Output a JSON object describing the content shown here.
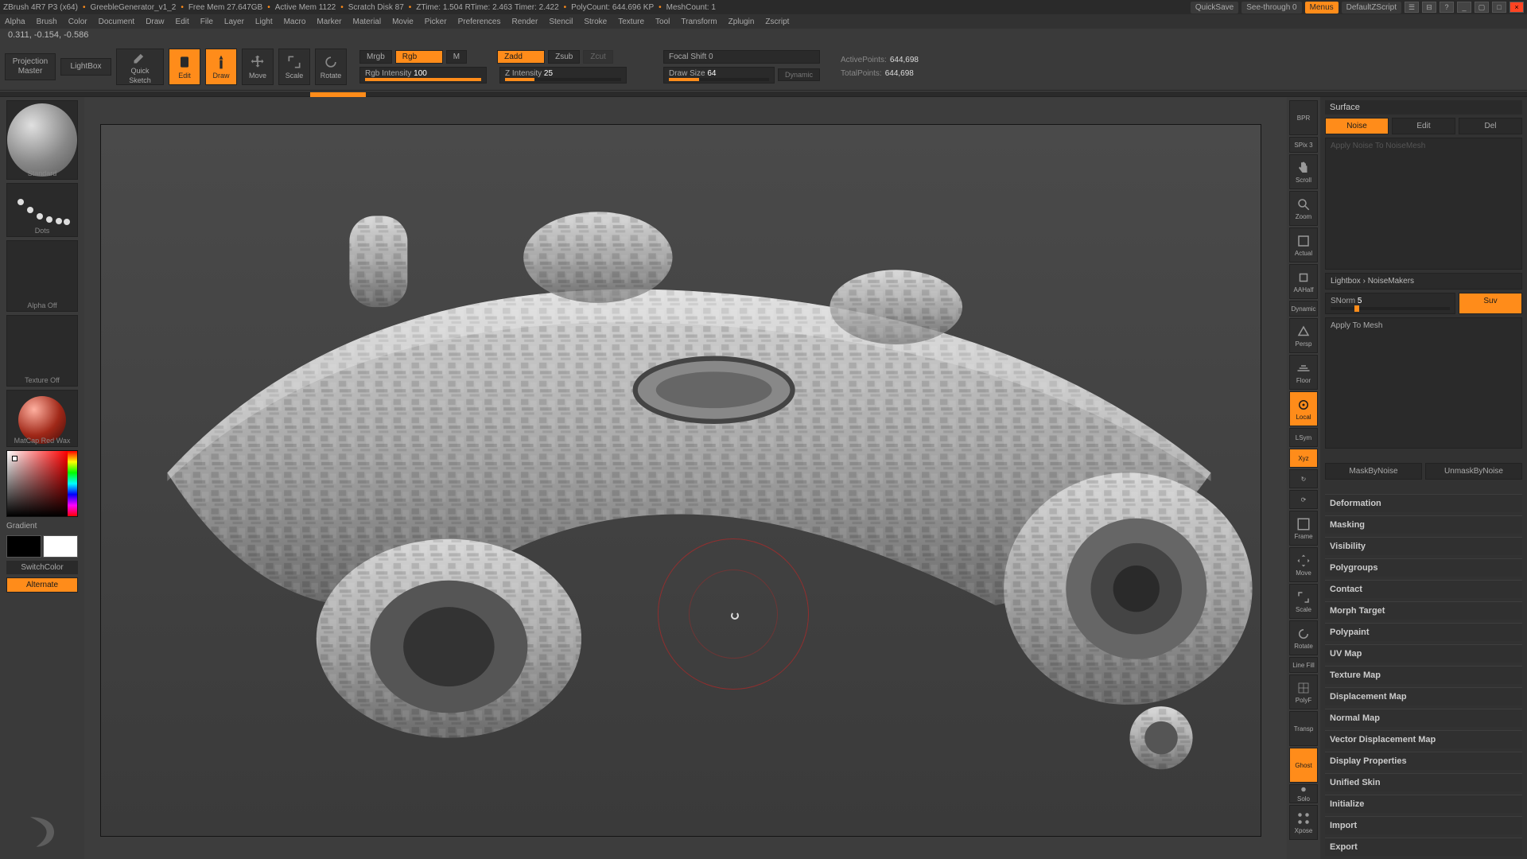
{
  "title": {
    "app": "ZBrush 4R7 P3 (x64)",
    "doc": "GreebleGenerator_v1_2",
    "freemem": "Free Mem 27.647GB",
    "activemem": "Active Mem 1122",
    "scratch": "Scratch Disk 87",
    "ztime": "ZTime: 1.504",
    "rtime": "RTime: 2.463",
    "timer": "Timer: 2.422",
    "polycount": "PolyCount: 644.696 KP",
    "meshcount": "MeshCount: 1",
    "quicksave": "QuickSave",
    "seethrough": "See-through  0",
    "menus": "Menus",
    "defaultscript": "DefaultZScript"
  },
  "menu": [
    "Alpha",
    "Brush",
    "Color",
    "Document",
    "Draw",
    "Edit",
    "File",
    "Layer",
    "Light",
    "Macro",
    "Marker",
    "Material",
    "Movie",
    "Picker",
    "Preferences",
    "Render",
    "Stencil",
    "Stroke",
    "Texture",
    "Tool",
    "Transform",
    "Zplugin",
    "Zscript"
  ],
  "coords": "0.311, -0.154, -0.586",
  "shelf": {
    "projection": [
      "Projection",
      "Master"
    ],
    "lightbox": "LightBox",
    "quicksketch": [
      "Quick",
      "Sketch"
    ],
    "modes": {
      "edit": "Edit",
      "draw": "Draw",
      "move": "Move",
      "scale": "Scale",
      "rotate": "Rotate"
    },
    "row1": {
      "mrgb": "Mrgb",
      "rgb": "Rgb",
      "m": "M",
      "zadd": "Zadd",
      "zsub": "Zsub",
      "zcut": "Zcut"
    },
    "row2": {
      "rgbint_label": "Rgb Intensity",
      "rgbint_val": "100",
      "zint_label": "Z Intensity",
      "zint_val": "25"
    },
    "focalshift": "Focal Shift 0",
    "drawsize_label": "Draw Size",
    "drawsize_val": "64",
    "dynamic": "Dynamic",
    "stats": {
      "active_l": "ActivePoints:",
      "active_v": "644,698",
      "total_l": "TotalPoints:",
      "total_v": "644,698"
    }
  },
  "left": {
    "brush_label": "Standard",
    "stroke_label": "Dots",
    "alpha_label": "Alpha Off",
    "texture_label": "Texture Off",
    "material_label": "MatCap Red Wax",
    "gradient": "Gradient",
    "switchcolor": "SwitchColor",
    "alternate": "Alternate"
  },
  "nav": {
    "bpr": "BPR",
    "spix_label": "SPix",
    "spix_val": "3",
    "scroll": "Scroll",
    "zoom": "Zoom",
    "actual": "Actual",
    "aahalf": "AAHalf",
    "persp": "Persp",
    "floor": "Floor",
    "local": "Local",
    "lsym": "LSym",
    "xyz": "Xyz",
    "frame": "Frame",
    "move": "Move",
    "scale": "Scale",
    "rotate": "Rotate",
    "linefill": "Line Fill",
    "polyf": "PolyF",
    "transp": "Transp",
    "ghost": "Ghost",
    "solo": "Solo",
    "xpose": "Xpose",
    "dynamic": "Dynamic"
  },
  "right": {
    "surface": "Surface",
    "noise": "Noise",
    "edit": "Edit",
    "del": "Del",
    "applynm": "Apply Noise To NoiseMesh",
    "lightbox_nm": "Lightbox › NoiseMakers",
    "snorm_label": "SNorm",
    "snorm_val": "5",
    "suv": "Suv",
    "applymesh": "Apply To Mesh",
    "maskby": "MaskByNoise",
    "unmaskby": "UnmaskByNoise",
    "accordion": [
      "Deformation",
      "Masking",
      "Visibility",
      "Polygroups",
      "Contact",
      "Morph Target",
      "Polypaint",
      "UV Map",
      "Texture Map",
      "Displacement Map",
      "Normal Map",
      "Vector Displacement Map",
      "Display Properties",
      "Unified Skin",
      "Initialize",
      "Import",
      "Export"
    ]
  }
}
